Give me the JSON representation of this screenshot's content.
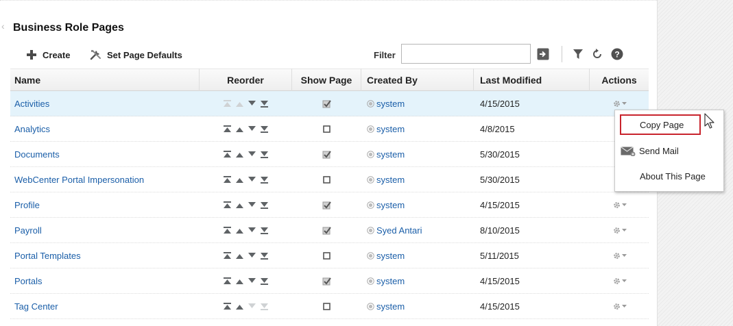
{
  "page": {
    "title": "Business Role Pages"
  },
  "toolbar": {
    "create_label": "Create",
    "set_defaults_label": "Set Page Defaults",
    "filter_label": "Filter",
    "filter_value": "",
    "filter_placeholder": ""
  },
  "columns": {
    "name": "Name",
    "reorder": "Reorder",
    "show_page": "Show Page",
    "created_by": "Created By",
    "last_modified": "Last Modified",
    "actions": "Actions"
  },
  "rows": [
    {
      "name": "Activities",
      "show": true,
      "created_by": "system",
      "modified": "4/15/2015",
      "reorder_enabled": [
        false,
        false,
        true,
        true
      ]
    },
    {
      "name": "Analytics",
      "show": false,
      "created_by": "system",
      "modified": "4/8/2015",
      "reorder_enabled": [
        true,
        true,
        true,
        true
      ]
    },
    {
      "name": "Documents",
      "show": true,
      "created_by": "system",
      "modified": "5/30/2015",
      "reorder_enabled": [
        true,
        true,
        true,
        true
      ]
    },
    {
      "name": "WebCenter Portal Impersonation",
      "show": false,
      "created_by": "system",
      "modified": "5/30/2015",
      "reorder_enabled": [
        true,
        true,
        true,
        true
      ]
    },
    {
      "name": "Profile",
      "show": true,
      "created_by": "system",
      "modified": "4/15/2015",
      "reorder_enabled": [
        true,
        true,
        true,
        true
      ]
    },
    {
      "name": "Payroll",
      "show": true,
      "created_by": "Syed Antari",
      "modified": "8/10/2015",
      "reorder_enabled": [
        true,
        true,
        true,
        true
      ]
    },
    {
      "name": "Portal Templates",
      "show": false,
      "created_by": "system",
      "modified": "5/11/2015",
      "reorder_enabled": [
        true,
        true,
        true,
        true
      ]
    },
    {
      "name": "Portals",
      "show": true,
      "created_by": "system",
      "modified": "4/15/2015",
      "reorder_enabled": [
        true,
        true,
        true,
        true
      ]
    },
    {
      "name": "Tag Center",
      "show": false,
      "created_by": "system",
      "modified": "4/15/2015",
      "reorder_enabled": [
        true,
        true,
        false,
        false
      ]
    }
  ],
  "actions_menu": {
    "items": [
      "Copy Page",
      "Send Mail",
      "About This Page"
    ],
    "highlighted": "Copy Page"
  },
  "colors": {
    "link": "#1a5ea8",
    "selected_row": "#e4f3fb",
    "highlight_border": "#c8232c"
  },
  "icons": {
    "create": "plus-icon",
    "set_defaults": "tools-icon",
    "go": "go-arrow-icon",
    "filter": "funnel-icon",
    "refresh": "refresh-icon",
    "help": "help-icon",
    "actions": "gear-icon",
    "send_mail": "mail-icon",
    "user": "user-status-icon"
  }
}
